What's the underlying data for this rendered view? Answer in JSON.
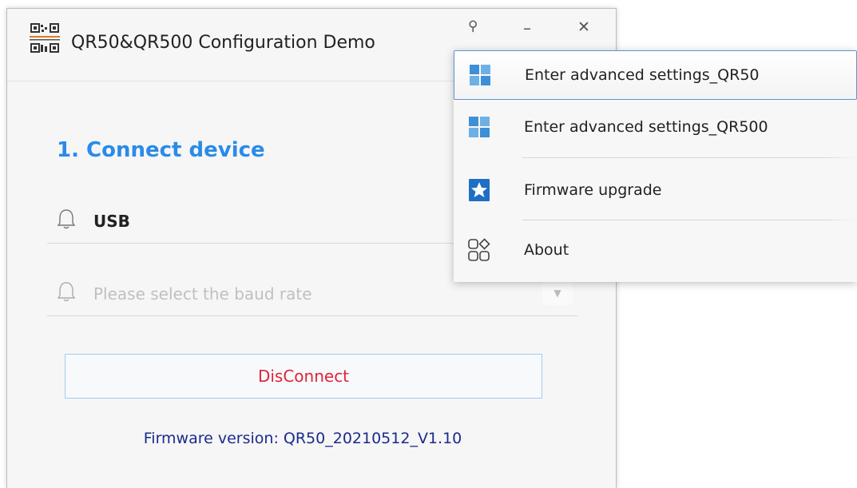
{
  "window": {
    "title": "QR50&QR500 Configuration Demo",
    "controls": {
      "pin": "⚲",
      "minimize": "–",
      "close": "✕"
    }
  },
  "connect": {
    "heading": "1. Connect device",
    "port_value": "USB",
    "baud_placeholder": "Please select the baud rate",
    "disconnect_label": "DisConnect",
    "firmware_version": "Firmware version: QR50_20210512_V1.10"
  },
  "menu": {
    "items": [
      {
        "label": "Enter advanced settings_QR50",
        "icon": "grid-icon"
      },
      {
        "label": "Enter advanced settings_QR500",
        "icon": "grid-icon"
      },
      {
        "label": "Firmware upgrade",
        "icon": "star-icon"
      },
      {
        "label": "About",
        "icon": "shapes-icon"
      }
    ]
  },
  "colors": {
    "accent": "#2a8be8",
    "danger": "#e0243a",
    "version_text": "#1c2a8c"
  }
}
